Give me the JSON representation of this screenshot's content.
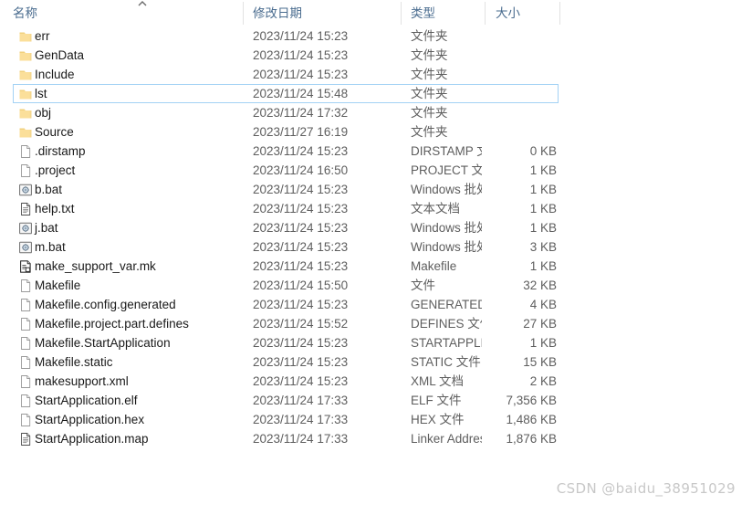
{
  "header": {
    "sort_indicator": "chevron-up-icon",
    "columns": [
      {
        "key": "name",
        "label": "名称"
      },
      {
        "key": "date",
        "label": "修改日期"
      },
      {
        "key": "type",
        "label": "类型"
      },
      {
        "key": "size",
        "label": "大小"
      }
    ]
  },
  "colors": {
    "header_text": "#4a6c8f",
    "row_text": "#1a1a1a",
    "meta_text": "#5e5e5e",
    "selection_border": "#a3d2f5",
    "folder_icon": "#fbdf9a",
    "folder_icon_edge": "#e9c46a",
    "divider": "#e2e2e2",
    "watermark": "#c8c8c8",
    "background": "#ffffff"
  },
  "rows": [
    {
      "icon": "folder-icon",
      "name": "err",
      "date": "2023/11/24 15:23",
      "type": "文件夹",
      "size": "",
      "selected": false
    },
    {
      "icon": "folder-icon",
      "name": "GenData",
      "date": "2023/11/24 15:23",
      "type": "文件夹",
      "size": "",
      "selected": false
    },
    {
      "icon": "folder-icon",
      "name": "Include",
      "date": "2023/11/24 15:23",
      "type": "文件夹",
      "size": "",
      "selected": false
    },
    {
      "icon": "folder-icon",
      "name": "lst",
      "date": "2023/11/24 15:48",
      "type": "文件夹",
      "size": "",
      "selected": true
    },
    {
      "icon": "folder-icon",
      "name": "obj",
      "date": "2023/11/24 17:32",
      "type": "文件夹",
      "size": "",
      "selected": false
    },
    {
      "icon": "folder-icon",
      "name": "Source",
      "date": "2023/11/27 16:19",
      "type": "文件夹",
      "size": "",
      "selected": false
    },
    {
      "icon": "blank-document-icon",
      "name": ".dirstamp",
      "date": "2023/11/24 15:23",
      "type": "DIRSTAMP 文件",
      "size": "0 KB",
      "selected": false
    },
    {
      "icon": "blank-document-icon",
      "name": ".project",
      "date": "2023/11/24 16:50",
      "type": "PROJECT 文件",
      "size": "1 KB",
      "selected": false
    },
    {
      "icon": "batch-script-icon",
      "name": "b.bat",
      "date": "2023/11/24 15:23",
      "type": "Windows 批处理...",
      "size": "1 KB",
      "selected": false
    },
    {
      "icon": "text-document-icon",
      "name": "help.txt",
      "date": "2023/11/24 15:23",
      "type": "文本文档",
      "size": "1 KB",
      "selected": false
    },
    {
      "icon": "batch-script-icon",
      "name": "j.bat",
      "date": "2023/11/24 15:23",
      "type": "Windows 批处理...",
      "size": "1 KB",
      "selected": false
    },
    {
      "icon": "batch-script-icon",
      "name": "m.bat",
      "date": "2023/11/24 15:23",
      "type": "Windows 批处理...",
      "size": "3 KB",
      "selected": false
    },
    {
      "icon": "makefile-icon",
      "name": "make_support_var.mk",
      "date": "2023/11/24 15:23",
      "type": "Makefile",
      "size": "1 KB",
      "selected": false
    },
    {
      "icon": "blank-document-icon",
      "name": "Makefile",
      "date": "2023/11/24 15:50",
      "type": "文件",
      "size": "32 KB",
      "selected": false
    },
    {
      "icon": "blank-document-icon",
      "name": "Makefile.config.generated",
      "date": "2023/11/24 15:23",
      "type": "GENERATED 文件",
      "size": "4 KB",
      "selected": false
    },
    {
      "icon": "blank-document-icon",
      "name": "Makefile.project.part.defines",
      "date": "2023/11/24 15:52",
      "type": "DEFINES 文件",
      "size": "27 KB",
      "selected": false
    },
    {
      "icon": "blank-document-icon",
      "name": "Makefile.StartApplication",
      "date": "2023/11/24 15:23",
      "type": "STARTAPPLICATI...",
      "size": "1 KB",
      "selected": false
    },
    {
      "icon": "blank-document-icon",
      "name": "Makefile.static",
      "date": "2023/11/24 15:23",
      "type": "STATIC 文件",
      "size": "15 KB",
      "selected": false
    },
    {
      "icon": "blank-document-icon",
      "name": "makesupport.xml",
      "date": "2023/11/24 15:23",
      "type": "XML 文档",
      "size": "2 KB",
      "selected": false
    },
    {
      "icon": "blank-document-icon",
      "name": "StartApplication.elf",
      "date": "2023/11/24 17:33",
      "type": "ELF 文件",
      "size": "7,356 KB",
      "selected": false
    },
    {
      "icon": "blank-document-icon",
      "name": "StartApplication.hex",
      "date": "2023/11/24 17:33",
      "type": "HEX 文件",
      "size": "1,486 KB",
      "selected": false
    },
    {
      "icon": "text-document-icon",
      "name": "StartApplication.map",
      "date": "2023/11/24 17:33",
      "type": "Linker Address ...",
      "size": "1,876 KB",
      "selected": false
    }
  ],
  "watermark": {
    "text": "CSDN @baidu_38951029"
  }
}
